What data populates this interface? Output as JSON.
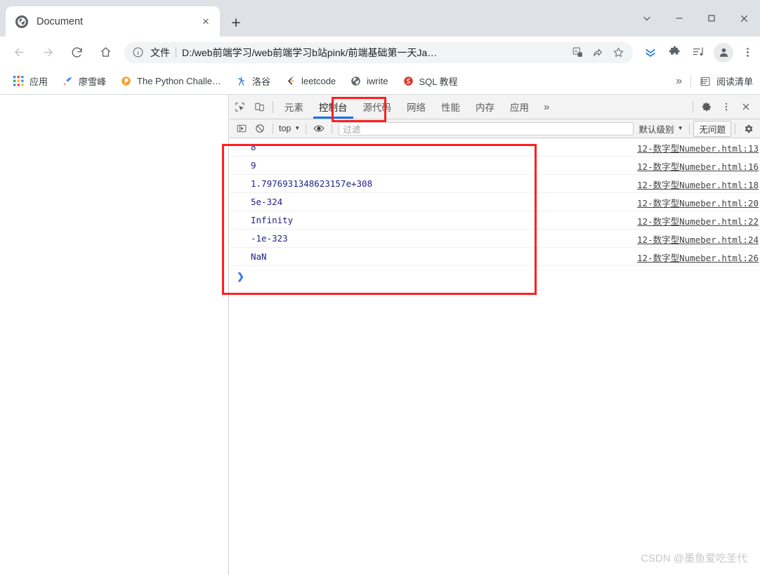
{
  "window": {
    "controls": [
      {
        "name": "collapse-button",
        "glyph": "chevron-down"
      },
      {
        "name": "minimize-button",
        "glyph": "minimize"
      },
      {
        "name": "maximize-button",
        "glyph": "maximize"
      },
      {
        "name": "close-button",
        "glyph": "close"
      }
    ]
  },
  "tabstrip": {
    "tab_title": "Document",
    "close_label": "×",
    "newtab_label": "+"
  },
  "toolbar": {
    "back_title": "后退",
    "forward_title": "前进",
    "reload_title": "重新加载",
    "home_title": "主页",
    "omnibox": {
      "scheme_label": "文件",
      "url": "D:/web前端学习/web前端学习b站pink/前端基础第一天Ja…"
    }
  },
  "bookmarks": {
    "items": [
      {
        "label": "应用",
        "icon": "apps-grid-icon"
      },
      {
        "label": "廖雪峰",
        "icon": "rocket-icon"
      },
      {
        "label": "The Python Challe…",
        "icon": "python-challenge-icon"
      },
      {
        "label": "洛谷",
        "icon": "luogu-icon"
      },
      {
        "label": "leetcode",
        "icon": "leetcode-icon"
      },
      {
        "label": "iwrite",
        "icon": "globe-icon"
      },
      {
        "label": "SQL 教程",
        "icon": "sql-icon"
      }
    ],
    "overflow_label": "»",
    "reading_list_label": "阅读清单"
  },
  "devtools": {
    "tabs": [
      {
        "label": "元素",
        "active": false
      },
      {
        "label": "控制台",
        "active": true
      },
      {
        "label": "源代码",
        "active": false
      },
      {
        "label": "网络",
        "active": false
      },
      {
        "label": "性能",
        "active": false
      },
      {
        "label": "内存",
        "active": false
      },
      {
        "label": "应用",
        "active": false
      }
    ],
    "tabs_overflow_label": "»",
    "console_toolbar": {
      "context_label": "top",
      "filter_placeholder": "过滤",
      "level_label": "默认级别",
      "issues_label": "无问题"
    },
    "console_logs": [
      {
        "message": "8",
        "source": "12-数字型Numeber.html:13"
      },
      {
        "message": "9",
        "source": "12-数字型Numeber.html:16"
      },
      {
        "message": "1.7976931348623157e+308",
        "source": "12-数字型Numeber.html:18"
      },
      {
        "message": "5e-324",
        "source": "12-数字型Numeber.html:20"
      },
      {
        "message": "Infinity",
        "source": "12-数字型Numeber.html:22"
      },
      {
        "message": "-1e-323",
        "source": "12-数字型Numeber.html:24"
      },
      {
        "message": "NaN",
        "source": "12-数字型Numeber.html:26"
      }
    ],
    "prompt_symbol": "❯"
  },
  "annotation": {
    "color": "#ff1f1f"
  },
  "watermark": "CSDN @墨鱼爱吃圣代"
}
